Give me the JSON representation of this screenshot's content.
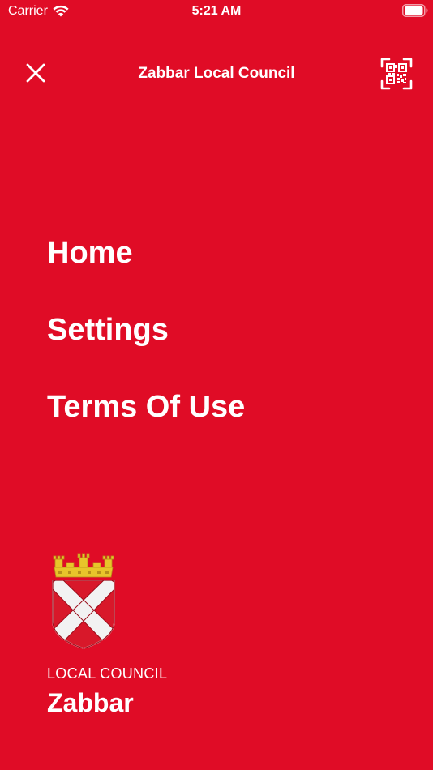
{
  "status_bar": {
    "carrier": "Carrier",
    "time": "5:21 AM",
    "wifi_icon": "wifi-icon",
    "battery_icon": "battery-icon"
  },
  "nav": {
    "title": "Zabbar Local Council",
    "close_icon": "close-icon",
    "qr_icon": "qr-code-icon"
  },
  "menu": {
    "items": [
      {
        "label": "Home"
      },
      {
        "label": "Settings"
      },
      {
        "label": "Terms Of Use"
      }
    ]
  },
  "footer": {
    "crest_icon": "coat-of-arms-icon",
    "council_label": "LOCAL COUNCIL",
    "council_name": "Zabbar"
  },
  "colors": {
    "background": "#e00c26",
    "foreground": "#ffffff",
    "crest_gold": "#e8c52a",
    "crest_red": "#d8182a",
    "crest_white": "#f2f2f2"
  }
}
